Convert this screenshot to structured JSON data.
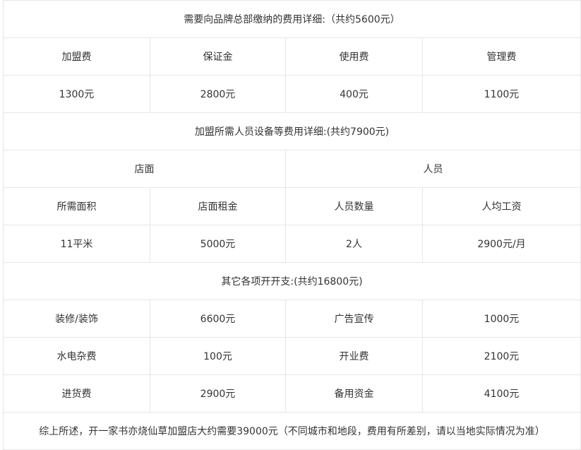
{
  "section1": {
    "title": "需要向品牌总部缴纳的费用详细:（共约5600元）",
    "headers": [
      "加盟费",
      "保证金",
      "使用费",
      "管理费"
    ],
    "values": [
      "1300元",
      "2800元",
      "400元",
      "1100元"
    ]
  },
  "section2": {
    "title": "加盟所需人员设备等费用详细:(共约7900元)",
    "groups": [
      "店面",
      "人员"
    ],
    "headers": [
      "所需面积",
      "店面租金",
      "人员数量",
      "人均工资"
    ],
    "values": [
      "11平米",
      "5000元",
      "2人",
      "2900元/月"
    ]
  },
  "section3": {
    "title": "其它各项开开支:(共约16800元)",
    "rows": [
      [
        "装修/装饰",
        "6600元",
        "广告宣传",
        "1000元"
      ],
      [
        "水电杂费",
        "100元",
        "开业费",
        "2100元"
      ],
      [
        "进货费",
        "2900元",
        "备用资金",
        "4100元"
      ]
    ]
  },
  "summary": "综上所述，开一家书亦烧仙草加盟店大约需要39000元（不同城市和地段，费用有所差别，请以当地实际情况为准）"
}
